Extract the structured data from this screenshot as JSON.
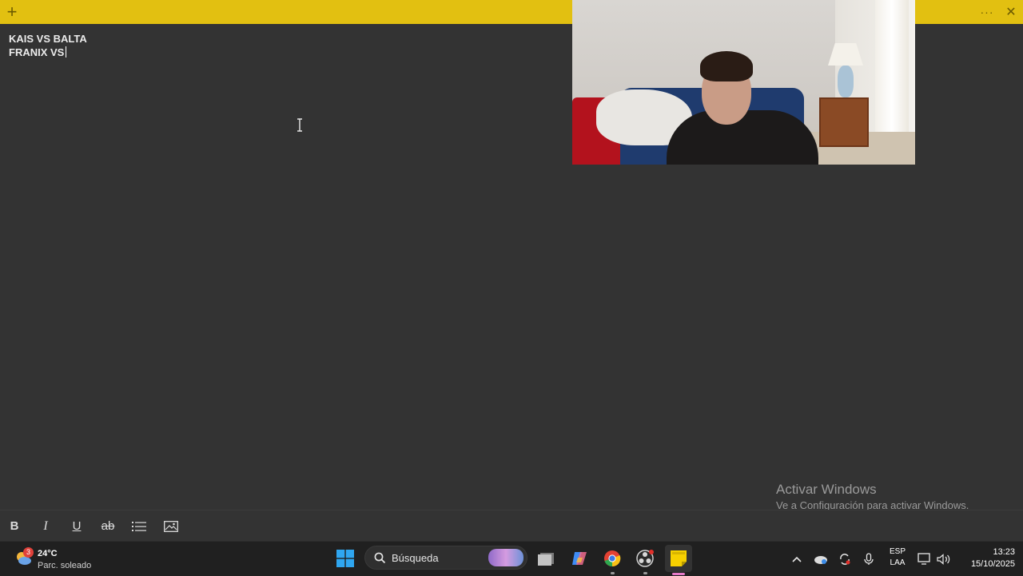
{
  "note": {
    "lines": [
      "KAIS VS BALTA",
      "FRANIX VS"
    ]
  },
  "titlebar": {
    "add_icon": "plus-icon",
    "more_icon": "more-dots-icon",
    "close_icon": "close-icon",
    "color": "#e2c011"
  },
  "watermark": {
    "title": "Activar Windows",
    "subtitle": "Ve a Configuración para activar Windows."
  },
  "format_toolbar": {
    "bold": "B",
    "italic": "I",
    "underline": "U",
    "strikethrough": "ab",
    "list_icon": "bulleted-list-icon",
    "image_icon": "image-icon"
  },
  "taskbar": {
    "weather": {
      "badge": "3",
      "temp": "24°C",
      "desc": "Parc. soleado"
    },
    "search": {
      "label": "Búsqueda"
    },
    "pinned": [
      "windows-start-icon",
      "file-explorer-icon",
      "copilot-icon",
      "chrome-icon",
      "obs-icon",
      "sticky-notes-icon"
    ],
    "tray": {
      "lang_top": "ESP",
      "lang_bottom": "LAA",
      "time": "13:23",
      "date": "15/10/2025"
    }
  }
}
